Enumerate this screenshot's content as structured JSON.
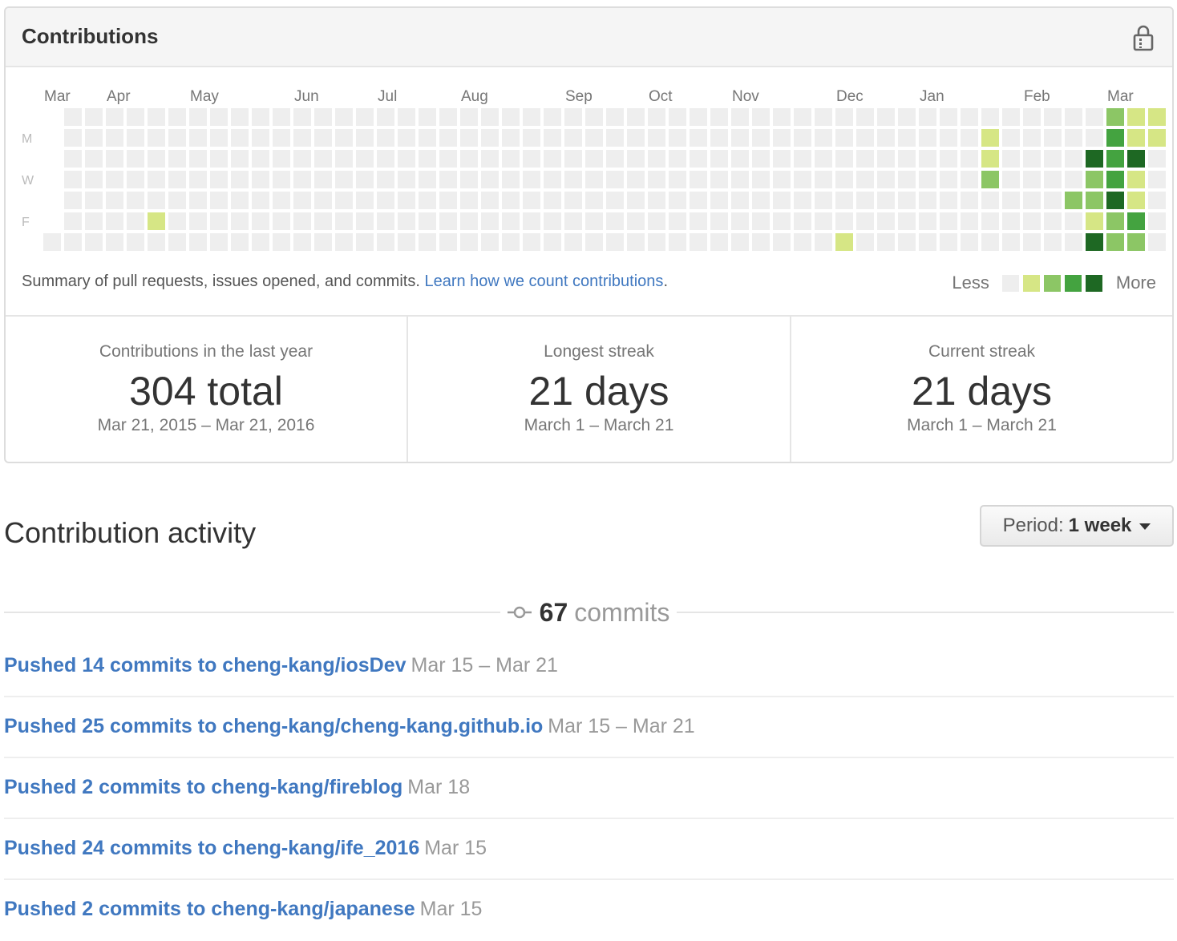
{
  "panel": {
    "title": "Contributions",
    "lock_icon": "lock-icon"
  },
  "calendar": {
    "months": [
      "Mar",
      "Apr",
      "May",
      "Jun",
      "Jul",
      "Aug",
      "Sep",
      "Oct",
      "Nov",
      "Dec",
      "Jan",
      "Feb",
      "Mar"
    ],
    "days": [
      "M",
      "W",
      "F"
    ],
    "colors": [
      "#eeeeee",
      "#d6e685",
      "#8cc665",
      "#44a340",
      "#1e6823"
    ],
    "weeks": 53,
    "first_week_start_day": 6,
    "last_week_end_day": 6,
    "active": [
      {
        "week": 5,
        "day": 5,
        "level": 1
      },
      {
        "week": 38,
        "day": 6,
        "level": 1
      },
      {
        "week": 45,
        "day": 1,
        "level": 1
      },
      {
        "week": 45,
        "day": 2,
        "level": 1
      },
      {
        "week": 45,
        "day": 3,
        "level": 2
      },
      {
        "week": 49,
        "day": 4,
        "level": 2
      },
      {
        "week": 50,
        "day": 2,
        "level": 4
      },
      {
        "week": 50,
        "day": 3,
        "level": 2
      },
      {
        "week": 50,
        "day": 4,
        "level": 2
      },
      {
        "week": 50,
        "day": 5,
        "level": 1
      },
      {
        "week": 50,
        "day": 6,
        "level": 4
      },
      {
        "week": 51,
        "day": 0,
        "level": 2
      },
      {
        "week": 51,
        "day": 1,
        "level": 3
      },
      {
        "week": 51,
        "day": 2,
        "level": 3
      },
      {
        "week": 51,
        "day": 3,
        "level": 3
      },
      {
        "week": 51,
        "day": 4,
        "level": 4
      },
      {
        "week": 51,
        "day": 5,
        "level": 2
      },
      {
        "week": 51,
        "day": 6,
        "level": 2
      },
      {
        "week": 52,
        "day": 0,
        "level": 1
      },
      {
        "week": 52,
        "day": 1,
        "level": 1
      },
      {
        "week": 52,
        "day": 2,
        "level": 4
      },
      {
        "week": 52,
        "day": 3,
        "level": 1
      },
      {
        "week": 52,
        "day": 4,
        "level": 1
      },
      {
        "week": 52,
        "day": 5,
        "level": 3
      },
      {
        "week": 52,
        "day": 6,
        "level": 2
      },
      {
        "week": 53,
        "day": 0,
        "level": 1
      },
      {
        "week": 53,
        "day": 1,
        "level": 1
      }
    ]
  },
  "summary": {
    "text": "Summary of pull requests, issues opened, and commits.",
    "link": "Learn how we count contributions",
    "period": "."
  },
  "legend": {
    "less": "Less",
    "more": "More"
  },
  "stats": [
    {
      "label": "Contributions in the last year",
      "value": "304 total",
      "range": "Mar 21, 2015 – Mar 21, 2016"
    },
    {
      "label": "Longest streak",
      "value": "21 days",
      "range": "March 1 – March 21"
    },
    {
      "label": "Current streak",
      "value": "21 days",
      "range": "March 1 – March 21"
    }
  ],
  "activity": {
    "title": "Contribution activity",
    "period_label": "Period:",
    "period_value": "1 week",
    "commits_count": "67",
    "commits_label": "commits",
    "items": [
      {
        "text": "Pushed 14 commits to cheng-kang/iosDev",
        "date": "Mar 15 – Mar 21"
      },
      {
        "text": "Pushed 25 commits to cheng-kang/cheng-kang.github.io",
        "date": "Mar 15 – Mar 21"
      },
      {
        "text": "Pushed 2 commits to cheng-kang/fireblog",
        "date": "Mar 18"
      },
      {
        "text": "Pushed 24 commits to cheng-kang/ife_2016",
        "date": "Mar 15"
      },
      {
        "text": "Pushed 2 commits to cheng-kang/japanese",
        "date": "Mar 15"
      }
    ]
  }
}
